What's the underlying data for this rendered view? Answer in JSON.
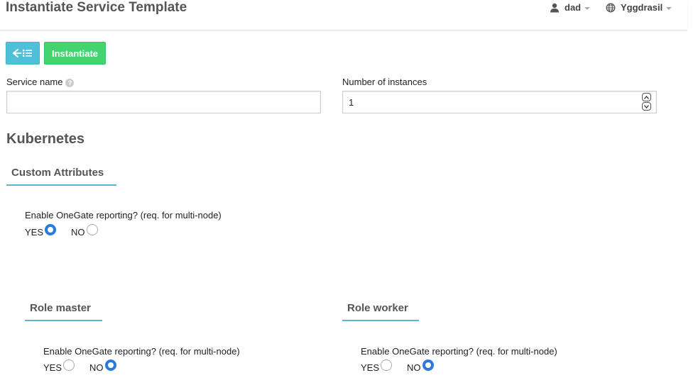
{
  "header": {
    "title": "Instantiate Service Template",
    "user": "dad",
    "zone": "Yggdrasil"
  },
  "toolbar": {
    "back_icon": "arrow-left-list-icon",
    "instantiate_label": "Instantiate"
  },
  "form": {
    "service_name_label": "Service name",
    "service_name_value": "",
    "instances_label": "Number of instances",
    "instances_value": "1"
  },
  "template": {
    "name": "Kubernetes",
    "custom_attributes_tab": "Custom Attributes",
    "onegate_label": "Enable OneGate reporting? (req. for multi-node)",
    "yes_label": "YES",
    "no_label": "NO",
    "onegate_selected": "YES"
  },
  "roles": [
    {
      "tab": "Role master",
      "onegate_label": "Enable OneGate reporting? (req. for multi-node)",
      "yes_label": "YES",
      "no_label": "NO",
      "onegate_selected": "NO"
    },
    {
      "tab": "Role worker",
      "onegate_label": "Enable OneGate reporting? (req. for multi-node)",
      "yes_label": "YES",
      "no_label": "NO",
      "onegate_selected": "NO"
    }
  ],
  "colors": {
    "back_button": "#4ec1d9",
    "instantiate_button": "#43d36f",
    "tab_underline": "#5bb7cf",
    "radio_checked": "#2a79df"
  }
}
